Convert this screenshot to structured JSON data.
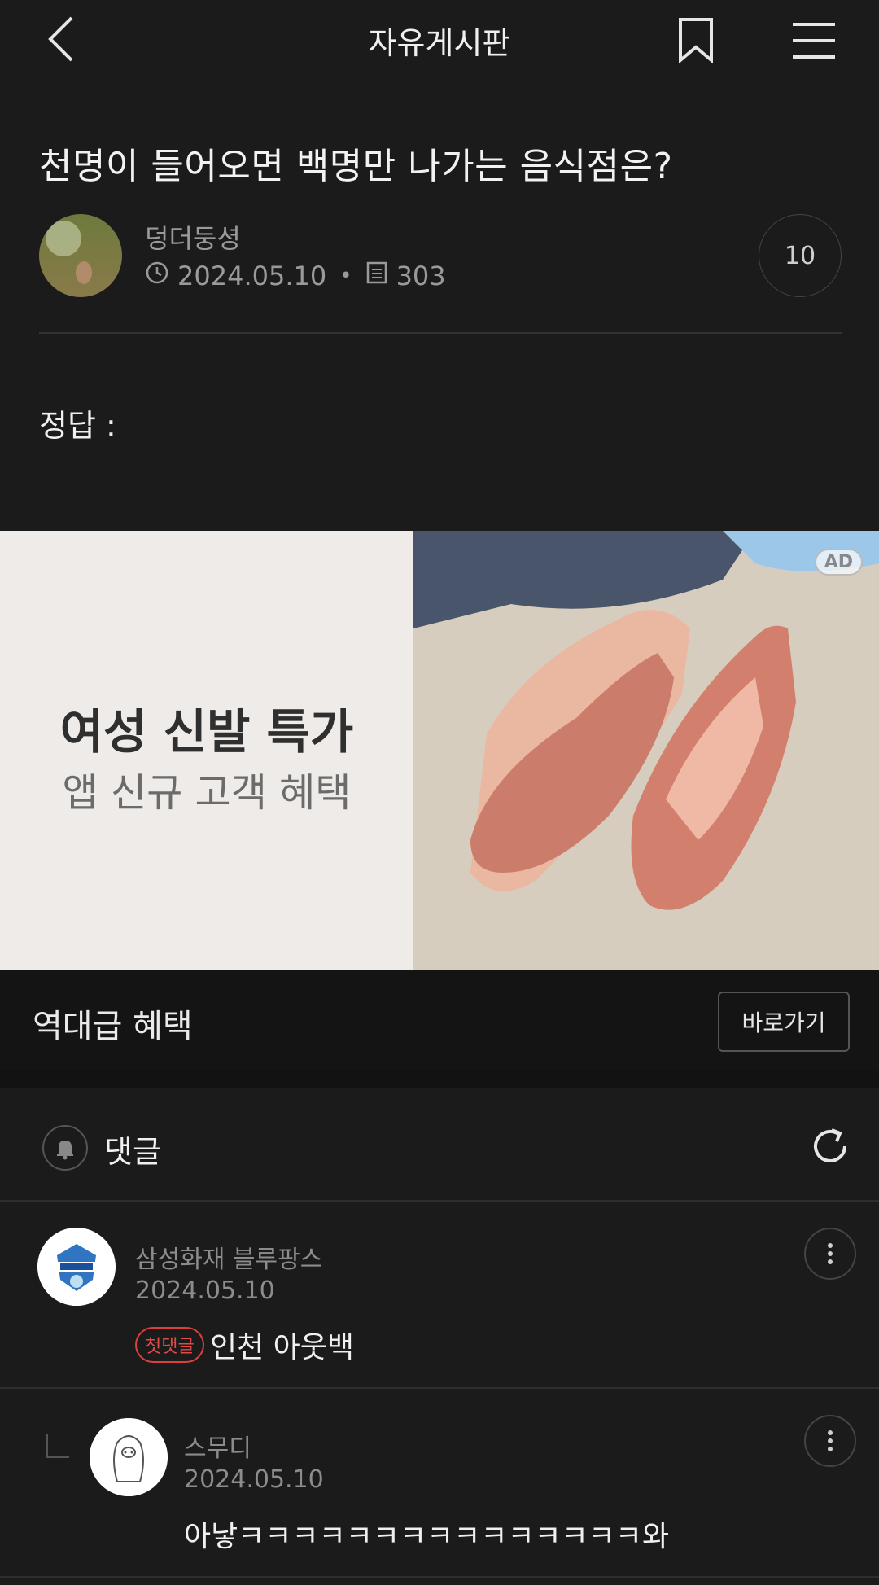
{
  "header": {
    "title": "자유게시판"
  },
  "post": {
    "title": "천명이 들어오면 백명만 나가는 음식점은?",
    "author": "덩더둥셩",
    "date": "2024.05.10",
    "views": "303",
    "comment_count": "10",
    "body": "정답 :"
  },
  "ad": {
    "headline": "여성 신발 특가",
    "subline": "앱 신규 고객 혜택",
    "badge": "AD",
    "bar_label": "역대급 혜택",
    "button_label": "바로가기"
  },
  "comments_section": {
    "label": "댓글",
    "items": [
      {
        "author": "삼성화재 블루팡스",
        "date": "2024.05.10",
        "badge": "첫댓글",
        "text": "인천 아웃백"
      },
      {
        "author": "스무디",
        "date": "2024.05.10",
        "text": "아낳ㅋㅋㅋㅋㅋㅋㅋㅋㅋㅋㅋㅋㅋㅋㅋ와"
      }
    ]
  },
  "colors": {
    "background": "#1b1b1b",
    "accent_badge": "#d9413e",
    "ad_panel": "#eeebe8"
  },
  "icons": [
    "back-icon",
    "bookmark-icon",
    "menu-icon",
    "clock-icon",
    "document-icon",
    "bell-icon",
    "refresh-icon",
    "more-icon"
  ]
}
